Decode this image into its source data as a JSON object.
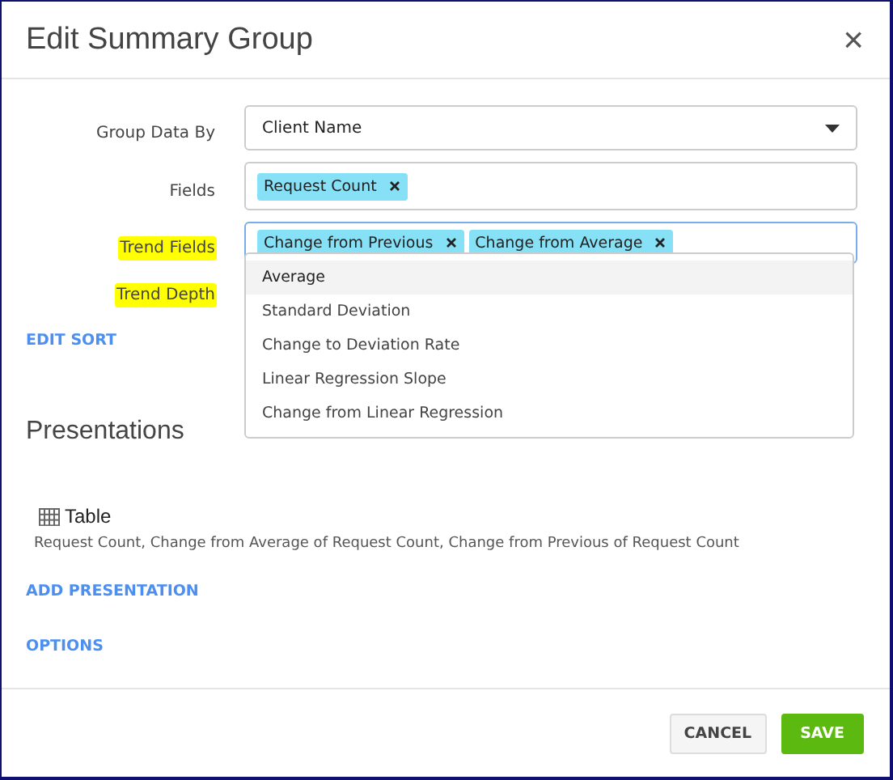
{
  "dialog": {
    "title": "Edit Summary Group",
    "close": "×"
  },
  "form": [
    {
      "kind": "select",
      "label": "Group Data By",
      "highlighted": false,
      "value": "Client Name"
    },
    {
      "kind": "chips",
      "label": "Fields",
      "highlighted": false,
      "focused": false,
      "chips": [
        "Request Count"
      ]
    },
    {
      "kind": "chips",
      "label": "Trend Fields",
      "highlighted": true,
      "focused": true,
      "chips": [
        "Change from Previous",
        "Change from Average"
      ]
    },
    {
      "kind": "hidden",
      "label": "Trend Depth",
      "highlighted": true
    }
  ],
  "dropdown": {
    "items": [
      {
        "label": "Average",
        "selected": true
      },
      {
        "label": "Standard Deviation",
        "selected": false
      },
      {
        "label": "Change to Deviation Rate",
        "selected": false
      },
      {
        "label": "Linear Regression Slope",
        "selected": false
      },
      {
        "label": "Change from Linear Regression",
        "selected": false
      }
    ]
  },
  "edit_sort": "EDIT SORT",
  "presentations": {
    "heading": "Presentations",
    "items": [
      {
        "name": "Table",
        "description": "Request Count, Change from Average of Request Count, Change from Previous of Request Count"
      }
    ],
    "add": "ADD PRESENTATION"
  },
  "options": "OPTIONS",
  "buttons": {
    "cancel": "CANCEL",
    "save": "SAVE"
  }
}
